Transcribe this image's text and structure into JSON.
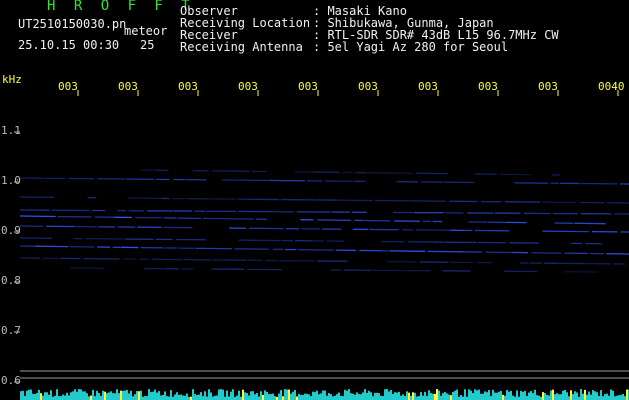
{
  "header": {
    "app_title": "H R O F F T",
    "filename": "UT2510150030.pn",
    "meteor_label": "meteor",
    "datetime": "25.10.15 00:30",
    "count": "25"
  },
  "info": [
    {
      "key": "Observer",
      "value": ": Masaki Kano"
    },
    {
      "key": "Receiving Location",
      "value": ": Shibukawa, Gunma, Japan"
    },
    {
      "key": "Receiver",
      "value": ": RTL-SDR SDR# 43dB L15 96.7MHz CW"
    },
    {
      "key": "Receiving Antenna",
      "value": ": 5el Yagi Az 280 for Seoul"
    }
  ],
  "axes": {
    "y_unit": "kHz",
    "x_ticks": [
      "003",
      "003",
      "003",
      "003",
      "003",
      "003",
      "003",
      "003",
      "003",
      "0040"
    ],
    "y_ticks": [
      "1.1",
      "1.0",
      "0.9",
      "0.8",
      "0.7",
      "0.6"
    ]
  },
  "colors": {
    "header_text": "#2ee62e",
    "info_text": "#f0f0f0",
    "tick_text": "#ffff33",
    "signal": "#3355ff",
    "noise_floor": "#22cccc"
  }
}
